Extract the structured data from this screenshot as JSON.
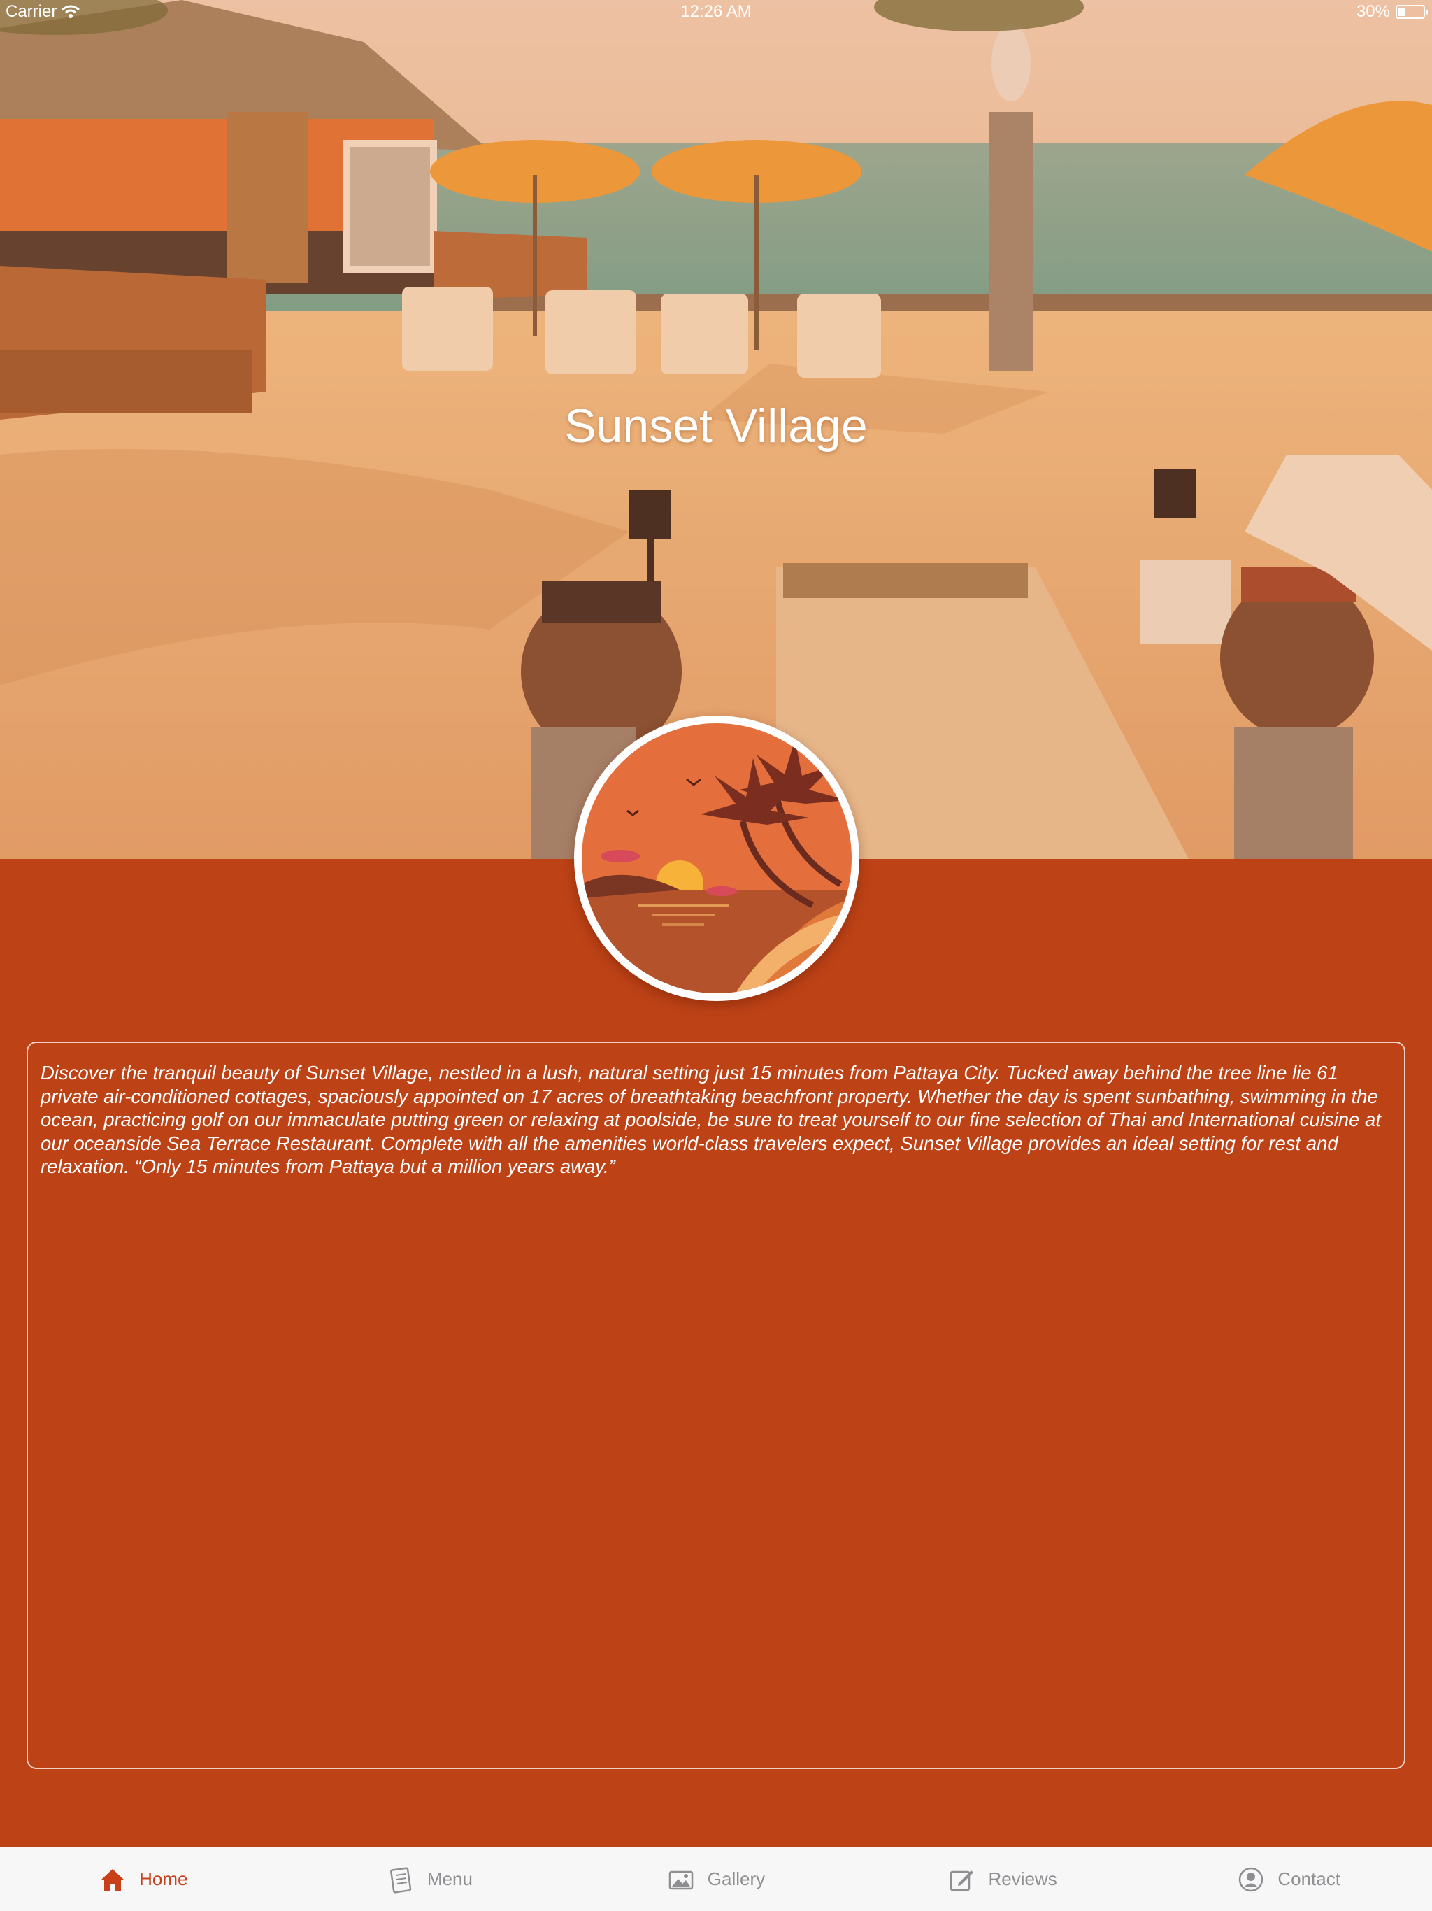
{
  "status_bar": {
    "carrier": "Carrier",
    "time": "12:26 AM",
    "battery": "30%"
  },
  "hero": {
    "title": "Sunset Village"
  },
  "logo": {
    "icon": "sunset-palm-logo"
  },
  "description": "Discover the tranquil beauty of Sunset Village, nestled in a lush, natural setting just 15 minutes from Pattaya City. Tucked away behind the tree line lie 61 private air-conditioned cottages, spaciously appointed on 17 acres of breathtaking beachfront property.  Whether the day is spent sunbathing, swimming in the ocean, practicing golf on our immaculate putting green or relaxing at poolside, be sure to treat yourself to our fine selection of Thai and International cuisine at our oceanside Sea Terrace Restaurant. Complete with all the amenities world-class travelers expect, Sunset Village provides an ideal setting for rest and relaxation.  “Only 15 minutes from Pattaya but a million years away.”",
  "tabs": [
    {
      "label": "Home",
      "icon": "home-icon",
      "active": true
    },
    {
      "label": "Menu",
      "icon": "menu-icon",
      "active": false
    },
    {
      "label": "Gallery",
      "icon": "gallery-icon",
      "active": false
    },
    {
      "label": "Reviews",
      "icon": "reviews-icon",
      "active": false
    },
    {
      "label": "Contact",
      "icon": "contact-icon",
      "active": false
    }
  ],
  "colors": {
    "accent": "#c7401a",
    "background": "#bd4216",
    "tab_inactive": "#8e8e93"
  }
}
